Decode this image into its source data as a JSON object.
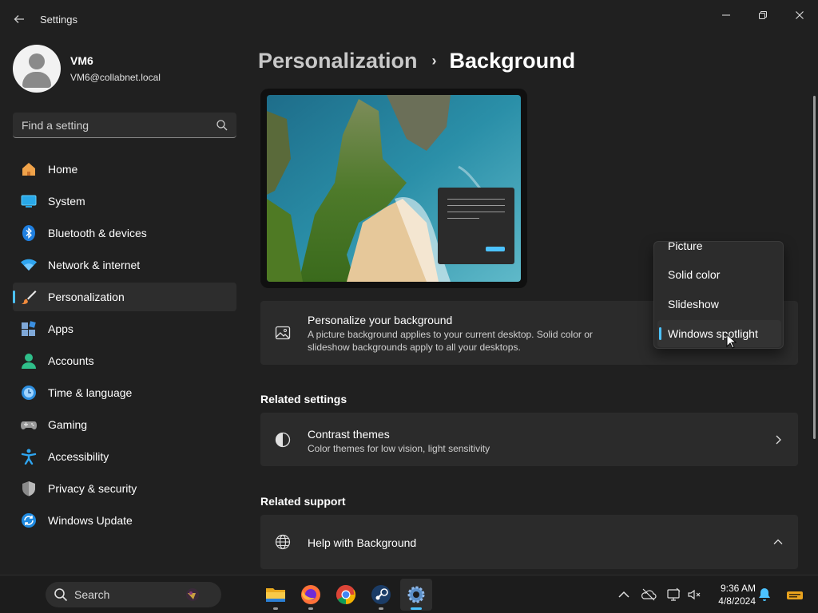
{
  "window": {
    "title": "Settings"
  },
  "profile": {
    "name": "VM6",
    "email": "VM6@collabnet.local"
  },
  "search": {
    "placeholder": "Find a setting"
  },
  "nav": [
    {
      "label": "Home",
      "icon": "home-icon"
    },
    {
      "label": "System",
      "icon": "system-icon"
    },
    {
      "label": "Bluetooth & devices",
      "icon": "bluetooth-icon"
    },
    {
      "label": "Network & internet",
      "icon": "wifi-icon"
    },
    {
      "label": "Personalization",
      "icon": "brush-icon",
      "active": true
    },
    {
      "label": "Apps",
      "icon": "apps-icon"
    },
    {
      "label": "Accounts",
      "icon": "accounts-icon"
    },
    {
      "label": "Time & language",
      "icon": "time-language-icon"
    },
    {
      "label": "Gaming",
      "icon": "gamepad-icon"
    },
    {
      "label": "Accessibility",
      "icon": "accessibility-icon"
    },
    {
      "label": "Privacy & security",
      "icon": "shield-icon"
    },
    {
      "label": "Windows Update",
      "icon": "windows-update-icon"
    }
  ],
  "breadcrumb": {
    "parent": "Personalization",
    "separator": "›",
    "current": "Background"
  },
  "background_card": {
    "title": "Personalize your background",
    "description": "A picture background applies to your current desktop. Solid color or slideshow backgrounds apply to all your desktops."
  },
  "dropdown": {
    "options": [
      "Picture",
      "Solid color",
      "Slideshow",
      "Windows spotlight"
    ],
    "selected": "Windows spotlight"
  },
  "related_settings": {
    "heading": "Related settings",
    "contrast": {
      "title": "Contrast themes",
      "description": "Color themes for low vision, light sensitivity"
    }
  },
  "related_support": {
    "heading": "Related support",
    "help": {
      "title": "Help with Background"
    }
  },
  "taskbar": {
    "search_label": "Search",
    "apps": [
      "file-explorer-icon",
      "firefox-icon",
      "chrome-icon",
      "steam-icon",
      "settings-icon"
    ],
    "time": "9:36 AM",
    "date": "4/8/2024"
  },
  "colors": {
    "accent": "#4cc2ff",
    "background": "#202020",
    "card": "#2b2b2b"
  }
}
